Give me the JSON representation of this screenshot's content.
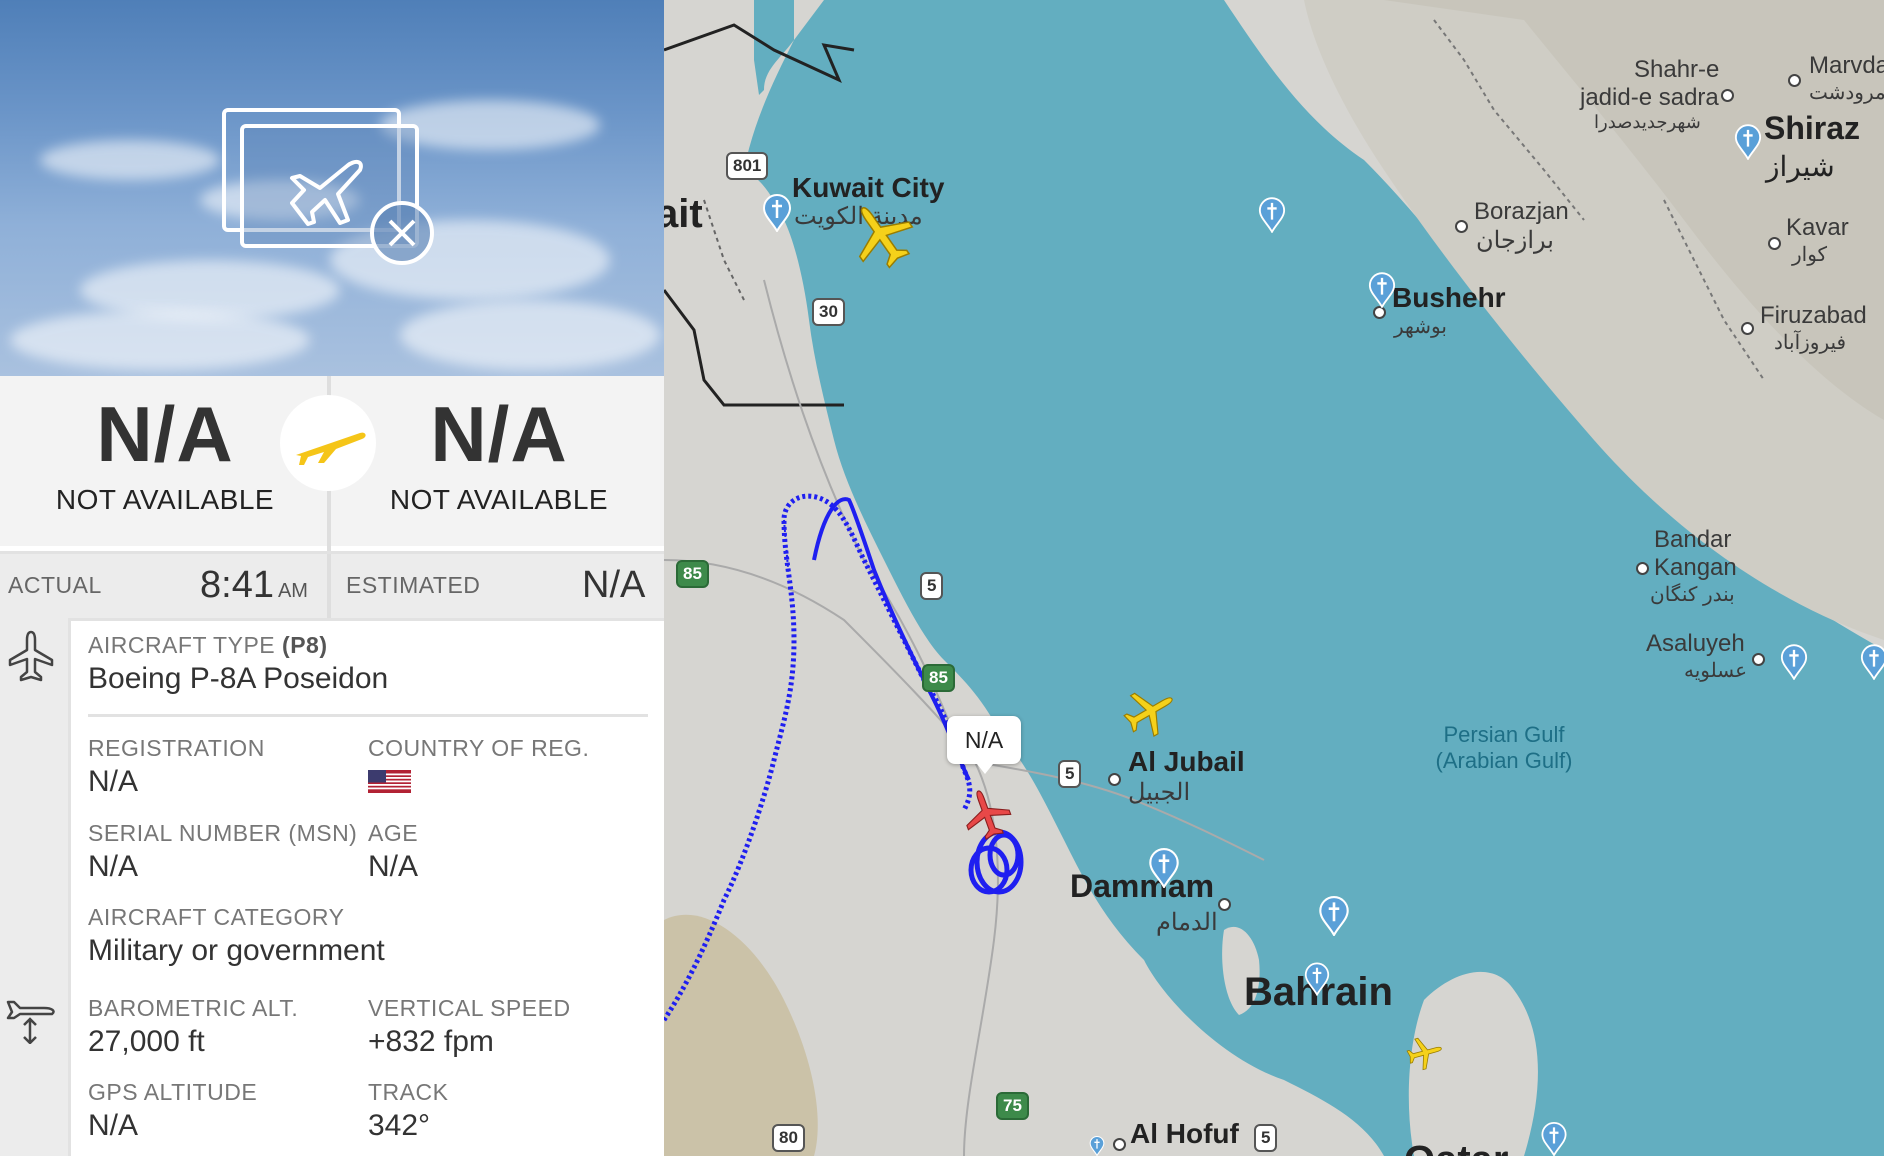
{
  "route": {
    "origin": {
      "code": "N/A",
      "name": "NOT AVAILABLE"
    },
    "destination": {
      "code": "N/A",
      "name": "NOT AVAILABLE"
    }
  },
  "times": {
    "actual_label": "ACTUAL",
    "actual_value": "8:41",
    "actual_ampm": "AM",
    "estimated_label": "ESTIMATED",
    "estimated_value": "N/A"
  },
  "details": {
    "aircraft_type_label": "AIRCRAFT TYPE",
    "aircraft_type_code": "(P8)",
    "aircraft_type_value": "Boeing P-8A Poseidon",
    "registration_label": "REGISTRATION",
    "registration_value": "N/A",
    "country_label": "COUNTRY OF REG.",
    "serial_label": "SERIAL NUMBER (MSN)",
    "serial_value": "N/A",
    "age_label": "AGE",
    "age_value": "N/A",
    "category_label": "AIRCRAFT CATEGORY",
    "category_value": "Military or government",
    "baro_label": "BAROMETRIC ALT.",
    "baro_value": "27,000 ft",
    "vspeed_label": "VERTICAL SPEED",
    "vspeed_value": "+832 fpm",
    "gps_label": "GPS ALTITUDE",
    "gps_value": "N/A",
    "track_label": "TRACK",
    "track_value": "342°"
  },
  "map": {
    "callout": "N/A",
    "labels": {
      "kuwait": "ait",
      "kuwait_city": "Kuwait City",
      "kuwait_city_ar": "مدينة الكويت",
      "shahr": "Shahr-e",
      "jadid": "jadid-e sadra",
      "jadid_ar": "شهرجدیدصدرا",
      "marvdasht": "Marvda",
      "marvdasht_ar": "مرودشت",
      "shiraz": "Shiraz",
      "shiraz_ar": "شیراز",
      "borazjan": "Borazjan",
      "borazjan_ar": "برازجان",
      "kavar": "Kavar",
      "kavar_ar": "کوار",
      "bushehr": "Bushehr",
      "bushehr_ar": "بوشهر",
      "firuzabad": "Firuzabad",
      "firuzabad_ar": "فیروزآباد",
      "bandar": "Bandar",
      "kangan": "Kangan",
      "kangan_ar": "بندر کنگان",
      "asaluyeh": "Asaluyeh",
      "asaluyeh_ar": "عسلویه",
      "sea1": "Persian Gulf",
      "sea2": "(Arabian Gulf)",
      "al_jubail": "Al Jubail",
      "al_jubail_ar": "الجبيل",
      "dammam": "Dammam",
      "dammam_ar": "الدمام",
      "bahrain": "Bahrain",
      "al_hofuf": "Al Hofuf",
      "qatar": "Qatar"
    },
    "shields": [
      "801",
      "30",
      "5",
      "85",
      "85",
      "5",
      "75",
      "80",
      "5"
    ]
  },
  "colors": {
    "track": "#1f1ff0",
    "sea": "#63aec0",
    "land": "#d6d5d1",
    "plane_yellow": "#f5d11a",
    "plane_selected": "#e84848"
  }
}
